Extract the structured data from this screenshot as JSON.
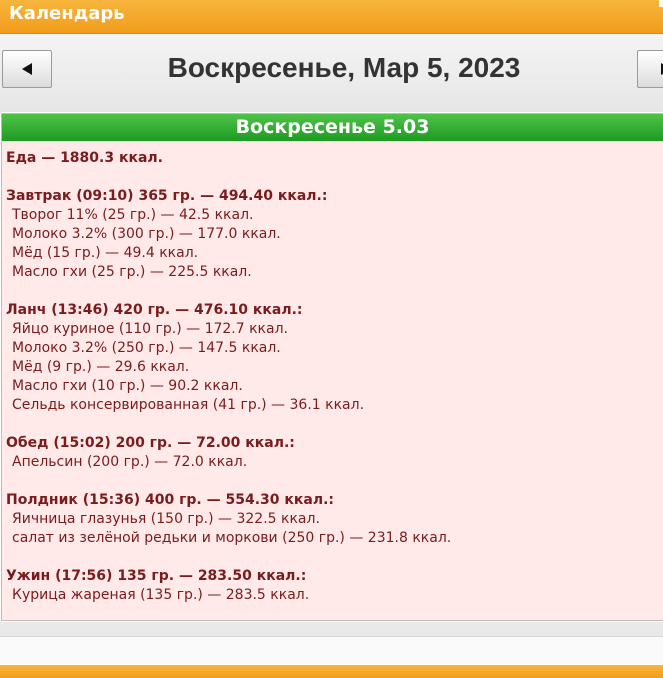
{
  "app": {
    "title": "Календарь"
  },
  "nav": {
    "prev_symbol": "◄",
    "next_symbol": "►",
    "date_title": "Воскресенье, Мар 5, 2023"
  },
  "day": {
    "header": "Воскресенье 5.03",
    "total": "Еда — 1880.3 ккал.",
    "meals": [
      {
        "heading": "Завтрак (09:10) 365 гр. — 494.40 ккал.:",
        "items": [
          "Творог 11% (25 гр.) — 42.5 ккал.",
          "Молоко 3.2% (300 гр.) — 177.0 ккал.",
          "Мёд (15 гр.) — 49.4 ккал.",
          "Масло гхи (25 гр.) — 225.5 ккал."
        ]
      },
      {
        "heading": "Ланч (13:46) 420 гр. — 476.10 ккал.:",
        "items": [
          "Яйцо куриное (110 гр.) — 172.7 ккал.",
          "Молоко 3.2% (250 гр.) — 147.5 ккал.",
          "Мёд (9 гр.) — 29.6 ккал.",
          "Масло гхи (10 гр.) — 90.2 ккал.",
          "Сельдь консервированная (41 гр.) — 36.1 ккал."
        ]
      },
      {
        "heading": "Обед (15:02) 200 гр. — 72.00 ккал.:",
        "items": [
          "Апельсин (200 гр.) — 72.0 ккал."
        ]
      },
      {
        "heading": "Полдник (15:36) 400 гр. — 554.30 ккал.:",
        "items": [
          "Яичница глазунья (150 гр.) — 322.5 ккал.",
          "салат из зелёной редьки и моркови (250 гр.) — 231.8 ккал."
        ]
      },
      {
        "heading": "Ужин (17:56) 135 гр. — 283.50 ккал.:",
        "items": [
          "Курица жареная (135 гр.) — 283.5 ккал."
        ]
      }
    ]
  },
  "colors": {
    "accent_orange": "#f29d1c",
    "day_header_green": "#1e9a22",
    "panel_bg": "#ffe9e9",
    "text_dark_red": "#7a1c1c"
  }
}
